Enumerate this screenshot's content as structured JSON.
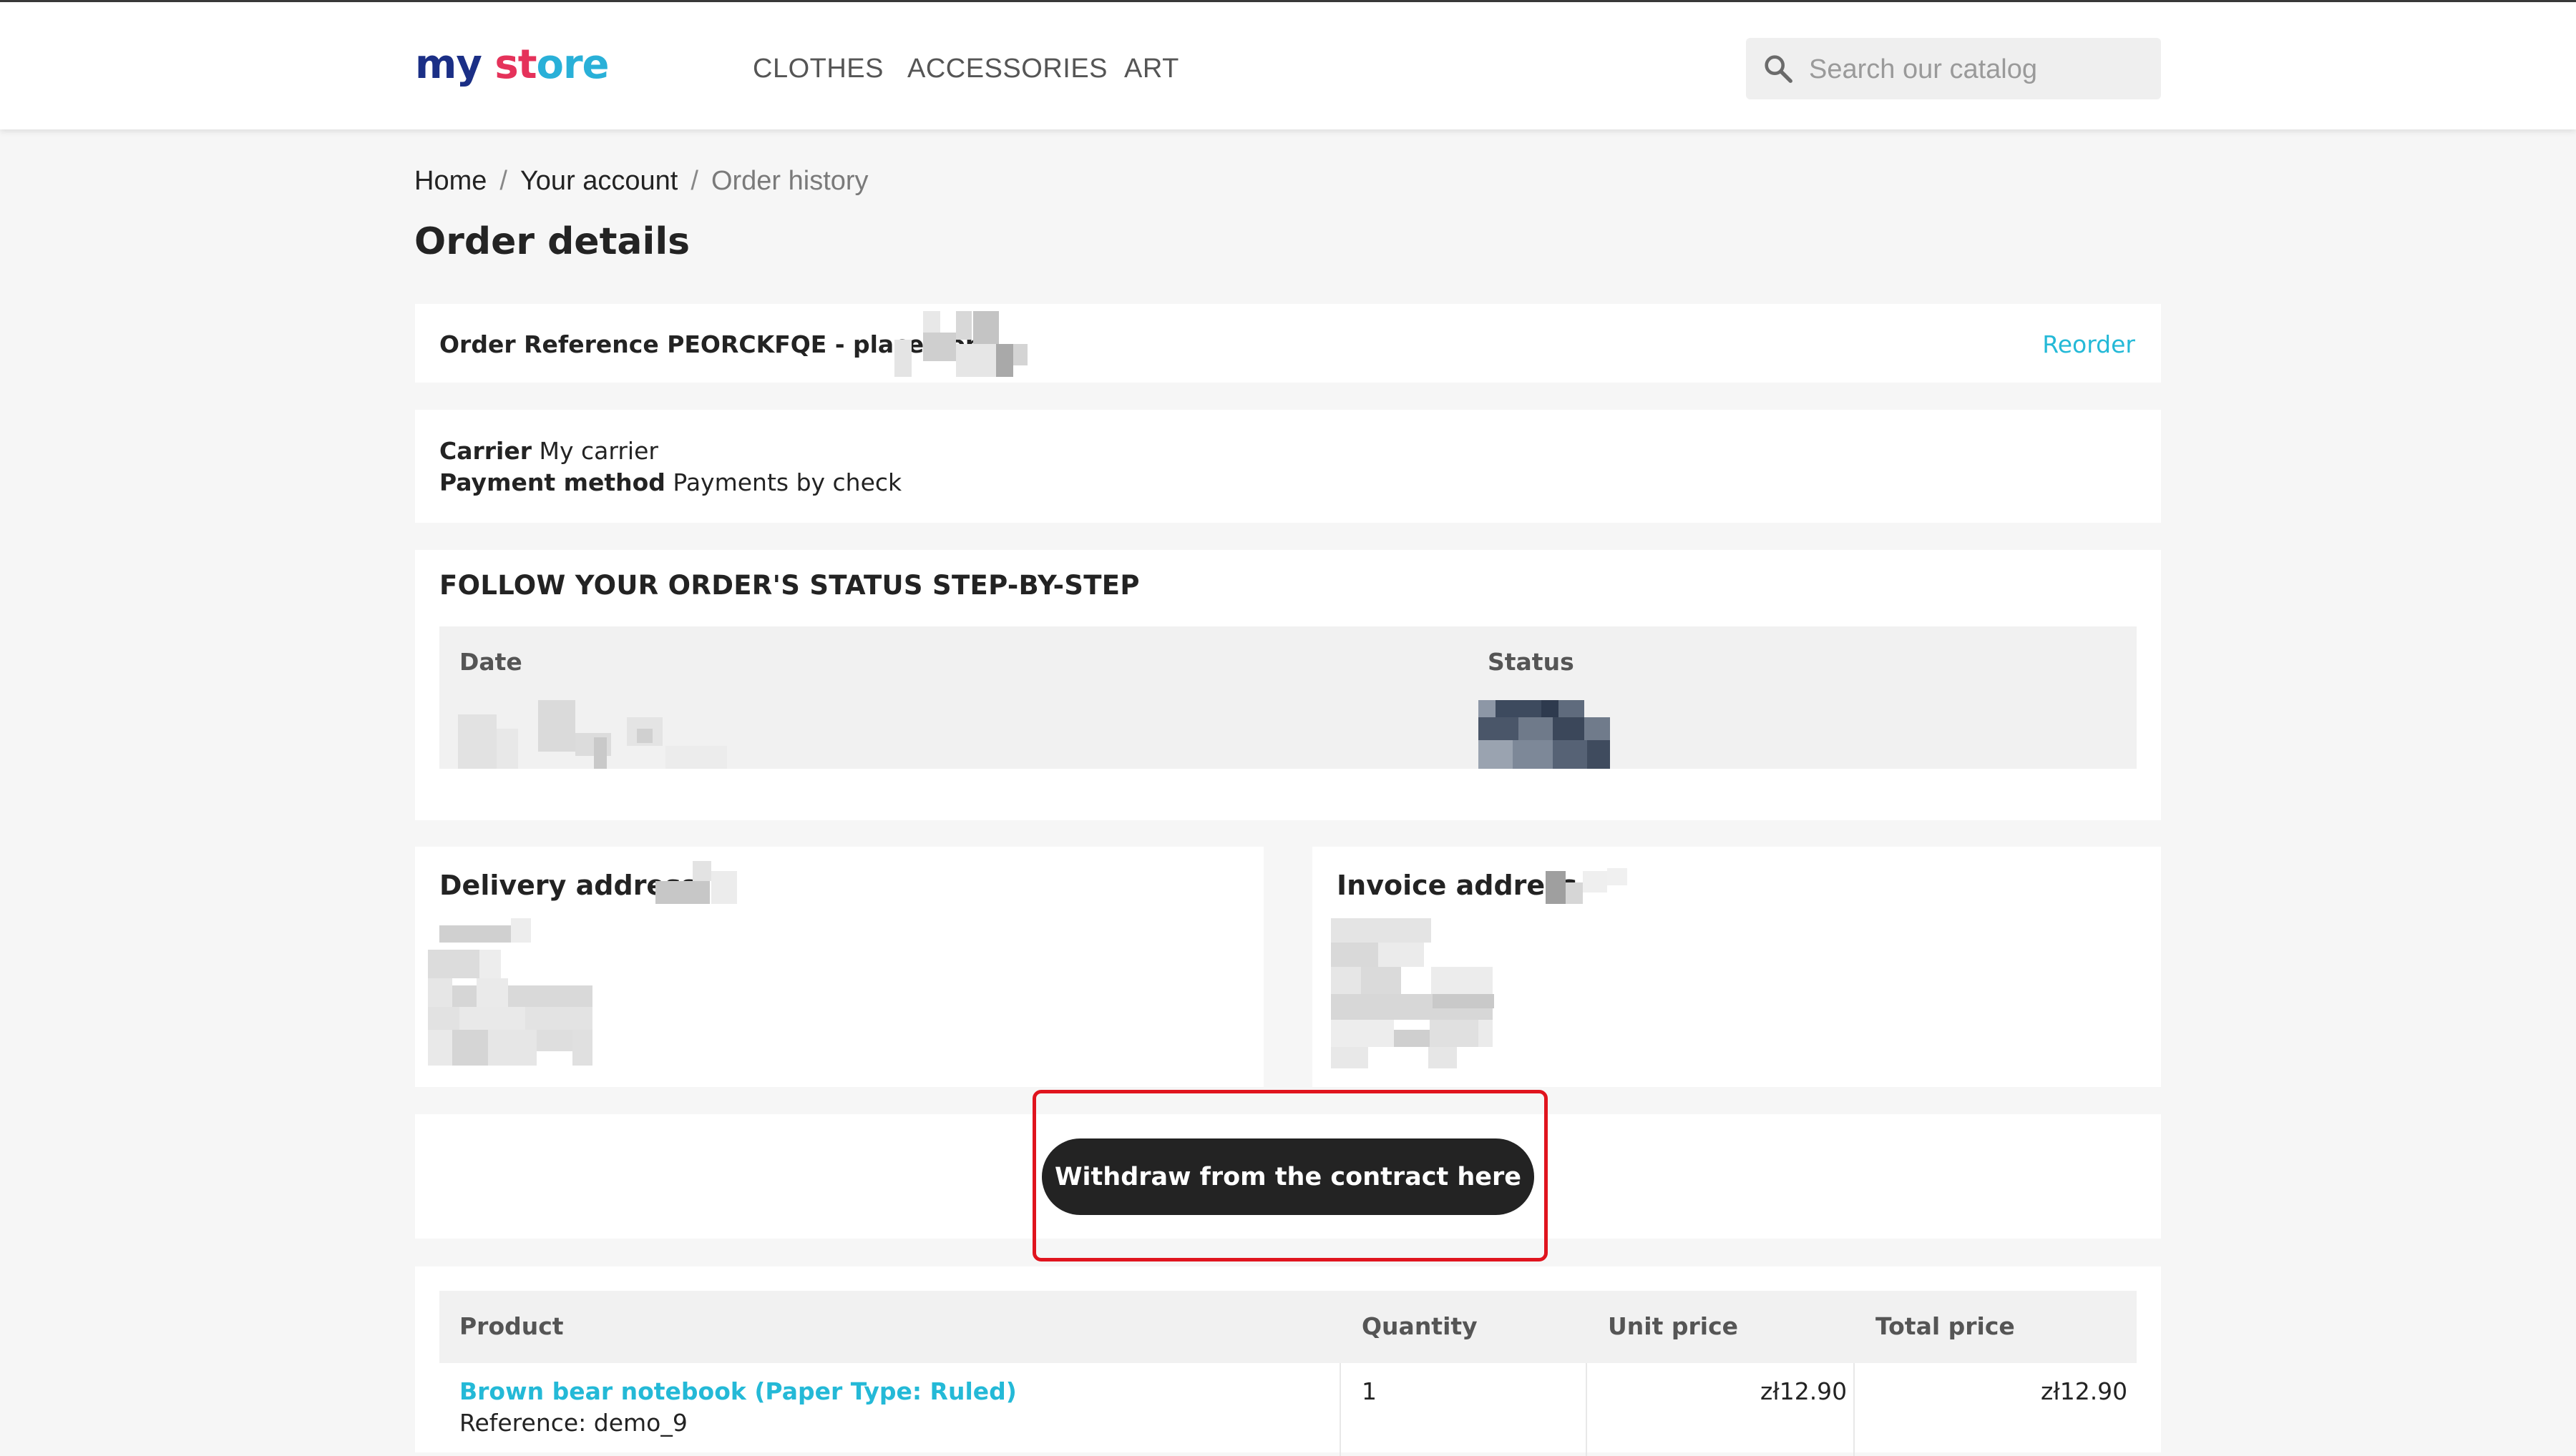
{
  "header": {
    "logo": {
      "part1": "my",
      "part2": "st",
      "part3": "ore"
    },
    "nav": [
      "CLOTHES",
      "ACCESSORIES",
      "ART"
    ],
    "search": {
      "placeholder": "Search our catalog",
      "icon": "search-icon"
    }
  },
  "breadcrumb": {
    "home": "Home",
    "account": "Your account",
    "current": "Order history",
    "separator": "/"
  },
  "page_title": "Order details",
  "order": {
    "reference_text": "Order Reference PEORCKFQE - placed on",
    "reorder_label": "Reorder",
    "carrier_label": "Carrier",
    "carrier_value": "My carrier",
    "payment_label": "Payment method",
    "payment_value": "Payments by check"
  },
  "status_section": {
    "title": "FOLLOW YOUR ORDER'S STATUS STEP-BY-STEP",
    "columns": [
      "Date",
      "Status"
    ]
  },
  "addresses": {
    "delivery_title": "Delivery address",
    "invoice_title": "Invoice address"
  },
  "withdraw_button": "Withdraw from the contract here",
  "products": {
    "columns": [
      "Product",
      "Quantity",
      "Unit price",
      "Total price"
    ],
    "rows": [
      {
        "name": "Brown bear notebook (Paper Type: Ruled)",
        "reference": "Reference: demo_9",
        "quantity": "1",
        "unit_price": "zł12.90",
        "total_price": "zł12.90"
      }
    ]
  },
  "colors": {
    "accent": "#24b9d7",
    "button": "#232323",
    "highlight": "#e0141e"
  }
}
